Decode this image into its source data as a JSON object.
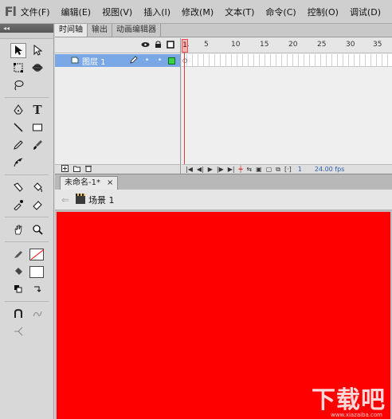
{
  "app": {
    "logo": "Fl"
  },
  "menu": [
    "文件(F)",
    "编辑(E)",
    "视图(V)",
    "插入(I)",
    "修改(M)",
    "文本(T)",
    "命令(C)",
    "控制(O)",
    "调试(D)"
  ],
  "tools_panel": {
    "collapse_glyph": "◂◂"
  },
  "timeline": {
    "tabs": [
      "时间轴",
      "输出",
      "动画编辑器"
    ],
    "active_tab": 0,
    "header_icons": [
      "eye-icon",
      "lock-icon",
      "outline-icon"
    ],
    "layer": {
      "name": "图层 1",
      "color": "#3bd34b"
    },
    "ruler_numbers": [
      "1",
      "5",
      "10",
      "15",
      "20",
      "25",
      "30",
      "35"
    ],
    "current_frame": "1",
    "fps": "24.00 fps"
  },
  "document": {
    "tab_title": "未命名-1*",
    "tab_close": "×",
    "scene": "场景 1",
    "stage_color": "#ff0000"
  },
  "watermark": {
    "text": "下载吧",
    "sub": "www.xiazaiba.com"
  }
}
